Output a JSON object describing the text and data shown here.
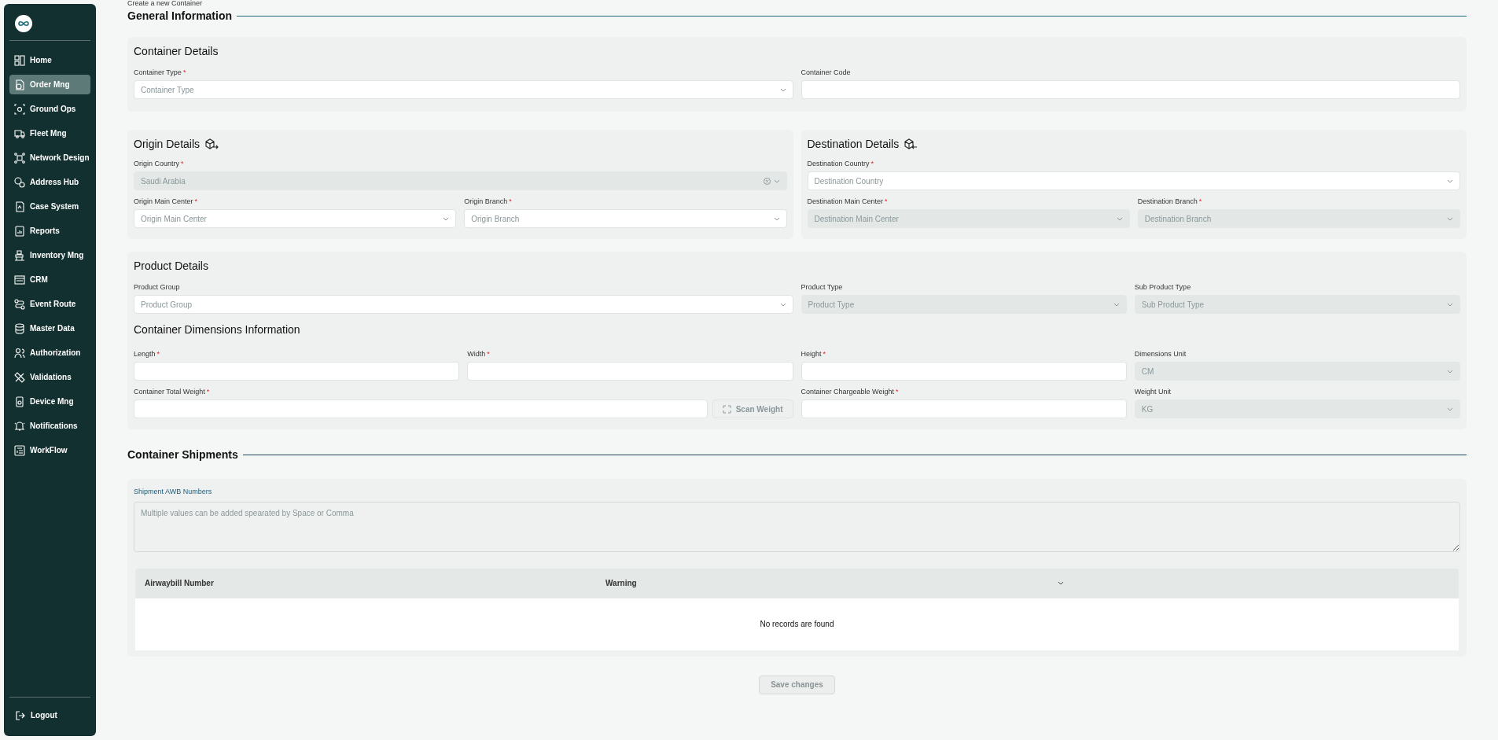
{
  "sidebar": {
    "items": [
      {
        "label": "Home",
        "selected": false
      },
      {
        "label": "Order Mng",
        "selected": true
      },
      {
        "label": "Ground Ops",
        "selected": false
      },
      {
        "label": "Fleet Mng",
        "selected": false
      },
      {
        "label": "Network Design",
        "selected": false
      },
      {
        "label": "Address Hub",
        "selected": false
      },
      {
        "label": "Case System",
        "selected": false
      },
      {
        "label": "Reports",
        "selected": false
      },
      {
        "label": "Inventory Mng",
        "selected": false
      },
      {
        "label": "CRM",
        "selected": false
      },
      {
        "label": "Event Route",
        "selected": false
      },
      {
        "label": "Master Data",
        "selected": false
      },
      {
        "label": "Authorization",
        "selected": false
      },
      {
        "label": "Validations",
        "selected": false
      },
      {
        "label": "Device Mng",
        "selected": false
      },
      {
        "label": "Notifications",
        "selected": false
      },
      {
        "label": "WorkFlow",
        "selected": false
      }
    ],
    "logout": "Logout"
  },
  "page_title": "Create a new Container",
  "general_title": "General Information",
  "container_details": {
    "title": "Container Details",
    "fields": [
      {
        "label": "Container Type",
        "required_mark": "*",
        "kind": "select",
        "placeholder": "Container Type",
        "disabled": false
      },
      {
        "label": "Container Code",
        "kind": "input",
        "disabled": false
      }
    ]
  },
  "origin": {
    "title": "Origin Details",
    "fields": [
      {
        "label": "Origin Country",
        "required_mark": "*",
        "kind": "select",
        "value": "Saudi Arabia",
        "disabled": true,
        "clearable": true
      },
      {
        "label": "Origin Main Center",
        "required_mark": "*",
        "kind": "select",
        "placeholder": "Origin Main Center",
        "disabled": false
      },
      {
        "label": "Origin Branch",
        "required_mark": "*",
        "kind": "select",
        "placeholder": "Origin Branch",
        "disabled": false
      }
    ]
  },
  "destination": {
    "title": "Destination Details",
    "fields": [
      {
        "label": "Destination Country",
        "required_mark": "*",
        "kind": "select",
        "placeholder": "Destination Country",
        "disabled": false
      },
      {
        "label": "Destination Main Center",
        "required_mark": "*",
        "kind": "select",
        "placeholder": "Destination Main Center",
        "disabled": true
      },
      {
        "label": "Destination Branch",
        "required_mark": "*",
        "kind": "select",
        "placeholder": "Destination Branch",
        "disabled": true
      }
    ]
  },
  "product_details": {
    "title": "Product Details",
    "fields": [
      {
        "label": "Product Group",
        "kind": "select",
        "placeholder": "Product Group",
        "disabled": false
      },
      {
        "label": "Product Type",
        "kind": "select",
        "placeholder": "Product Type",
        "disabled": true
      },
      {
        "label": "Sub Product Type",
        "kind": "select",
        "placeholder": "Sub Product Type",
        "disabled": true
      }
    ]
  },
  "dimensions": {
    "title": "Container Dimensions Information",
    "fields": [
      {
        "label": "Length",
        "required_mark": "*",
        "kind": "input",
        "disabled": false
      },
      {
        "label": "Width",
        "required_mark": "*",
        "kind": "input",
        "disabled": false
      },
      {
        "label": "Height",
        "required_mark": "*",
        "kind": "input",
        "disabled": false
      },
      {
        "label": "Dimensions Unit",
        "kind": "select",
        "value": "CM",
        "disabled": true
      },
      {
        "label": "Container Total Weight",
        "required_mark": "*",
        "kind": "input",
        "disabled": false,
        "button": "Scan Weight"
      },
      {
        "label": "Container Chargeable Weight",
        "required_mark": "*",
        "kind": "input",
        "disabled": false
      },
      {
        "label": "Weight Unit",
        "kind": "select",
        "value": "KG",
        "disabled": true
      }
    ]
  },
  "shipments": {
    "title": "Container Shipments",
    "awb_label": "Shipment AWB Numbers",
    "awb_placeholder": "Multiple values can be added spearated by Space or Comma",
    "table": {
      "columns": [
        "Airwaybill Number",
        "Warning"
      ],
      "empty_text": "No records are found"
    }
  },
  "save_button": "Save changes"
}
